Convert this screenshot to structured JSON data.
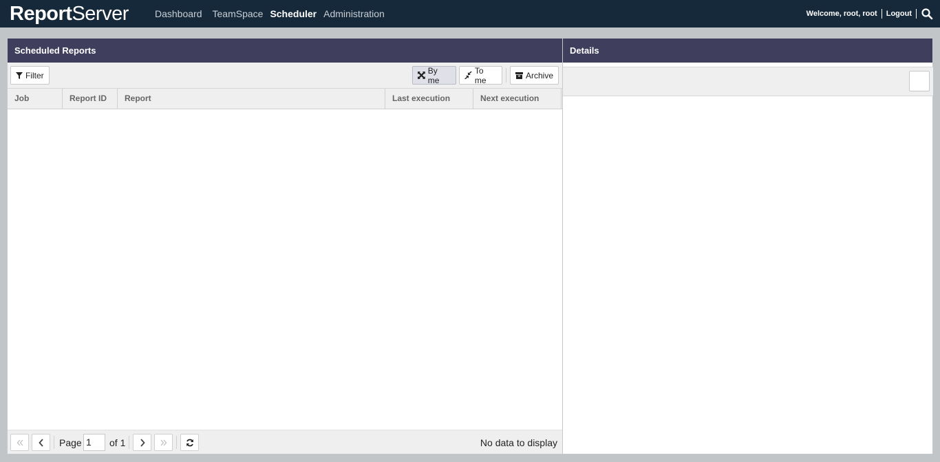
{
  "app": {
    "logo_bold": "Report",
    "logo_thin": "Server"
  },
  "nav": {
    "items": [
      {
        "label": "Dashboard",
        "active": false
      },
      {
        "label": "TeamSpace",
        "active": false
      },
      {
        "label": "Scheduler",
        "active": true
      },
      {
        "label": "Administration",
        "active": false
      }
    ]
  },
  "user": {
    "welcome": "Welcome, root, root",
    "logout": "Logout",
    "search_icon": "search-icon"
  },
  "scheduled": {
    "title": "Scheduled Reports",
    "toolbar": {
      "filter_label": "Filter",
      "by_me_label": "By me",
      "to_me_label": "To me",
      "archive_label": "Archive"
    },
    "columns": [
      "Job",
      "Report ID",
      "Report",
      "Last execution",
      "Next execution"
    ],
    "rows": []
  },
  "pager": {
    "page_label": "Page",
    "page_value": "1",
    "of_label": "of 1",
    "status": "No data to display"
  },
  "details": {
    "title": "Details"
  },
  "colors": {
    "topbar": "#16293a",
    "panel_header": "#403e5d",
    "background": "#c1c5c8"
  }
}
